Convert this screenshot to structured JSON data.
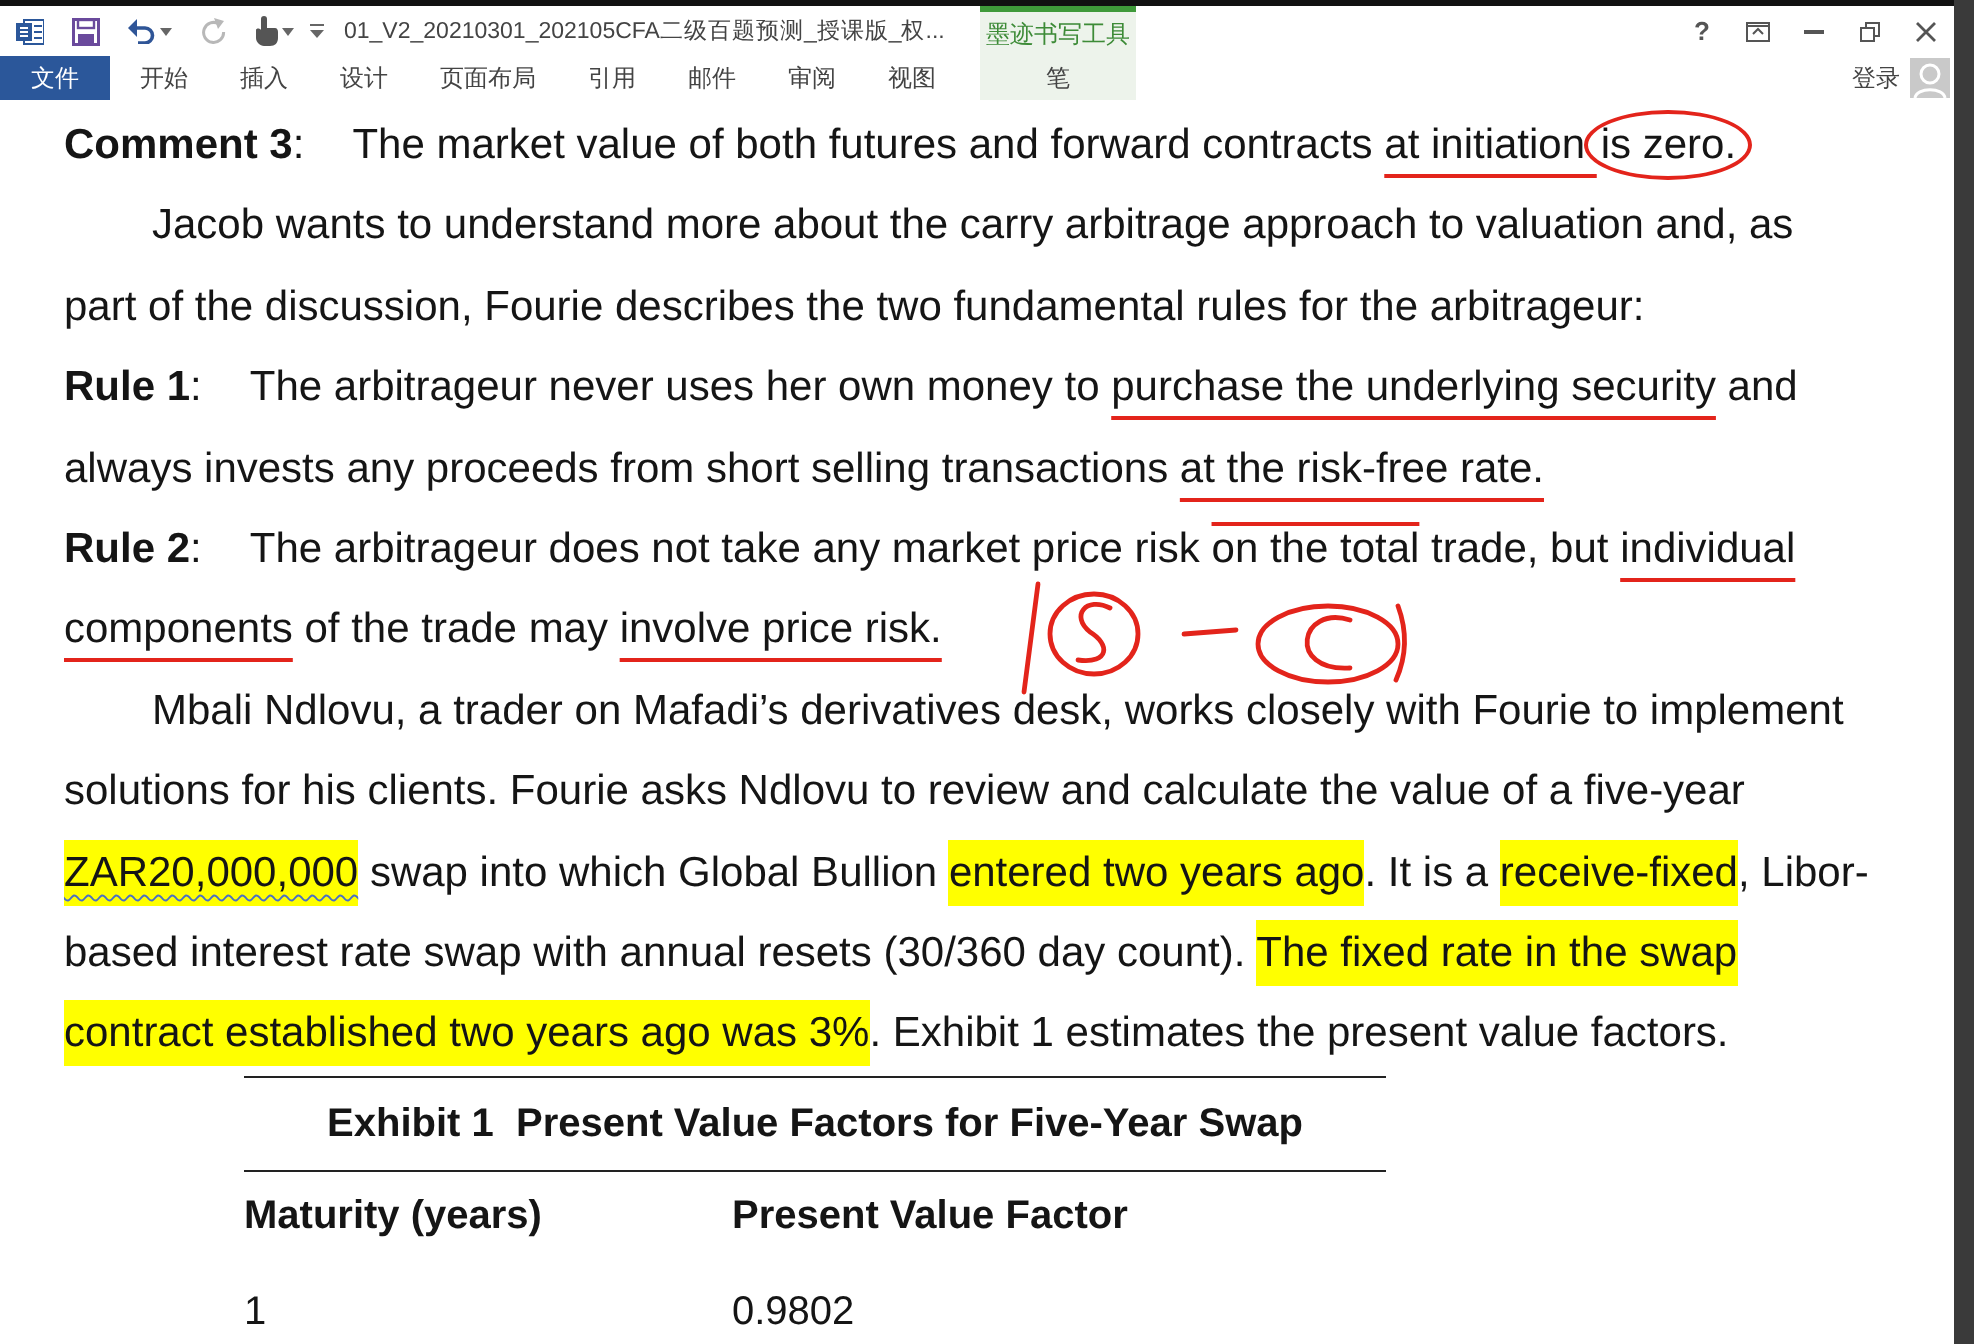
{
  "title_bar": {
    "quick_access": [
      {
        "kind": "save",
        "disabled": false,
        "dropdown": false
      },
      {
        "kind": "undo",
        "disabled": false,
        "dropdown": true
      },
      {
        "kind": "redo",
        "disabled": true,
        "dropdown": false
      },
      {
        "kind": "touch",
        "disabled": false,
        "dropdown": true
      }
    ],
    "title": "01_V2_20210301_202105CFA二级百题预测_授课版_权...",
    "contextual_group": "墨迹书写工具",
    "help": "?"
  },
  "ribbon": {
    "tabs": [
      {
        "label": "文件",
        "kind": "file",
        "selected": false
      },
      {
        "label": "开始",
        "kind": "normal",
        "selected": false
      },
      {
        "label": "插入",
        "kind": "normal",
        "selected": false
      },
      {
        "label": "设计",
        "kind": "normal",
        "selected": false
      },
      {
        "label": "页面布局",
        "kind": "normal",
        "selected": false
      },
      {
        "label": "引用",
        "kind": "normal",
        "selected": false
      },
      {
        "label": "邮件",
        "kind": "normal",
        "selected": false
      },
      {
        "label": "审阅",
        "kind": "normal",
        "selected": false
      },
      {
        "label": "视图",
        "kind": "normal",
        "selected": false
      },
      {
        "label": "笔",
        "kind": "contextual",
        "selected": false
      }
    ],
    "sign_in": "登录"
  },
  "document": {
    "paragraphs": [
      {
        "label": "**Comment 3**:",
        "indent": false,
        "ink_sketch": false,
        "lines": [
          [
            {
              "text": "The market value of both futures and forward contracts ",
              "kind": "plain"
            },
            {
              "text": "at initiation ",
              "kind": "underline"
            },
            {
              "text": "is zero.",
              "kind": "circle"
            }
          ]
        ]
      },
      {
        "indent": true,
        "ink_sketch": false,
        "lines": [
          [
            {
              "text": "Jacob wants to understand more about the carry arbitrage approach to valuation and, as",
              "kind": "plain"
            }
          ],
          [
            {
              "text": "part of the discussion, Fourie describes the two fundamental rules for the arbitrageur:",
              "kind": "plain"
            }
          ]
        ]
      },
      {
        "label": "**Rule 1**:",
        "indent": false,
        "ink_sketch": false,
        "lines": [
          [
            {
              "text": "The arbitrageur never uses her own money to ",
              "kind": "plain"
            },
            {
              "text": "purchase the underlying security",
              "kind": "underline"
            },
            {
              "text": " and",
              "kind": "plain"
            }
          ],
          [
            {
              "text": "always invests any proceeds from short selling transactions ",
              "kind": "plain"
            },
            {
              "text": "at the risk-free rate.",
              "kind": "underline"
            }
          ]
        ]
      },
      {
        "label": "**Rule 2**:",
        "indent": false,
        "ink_sketch": true,
        "lines": [
          [
            {
              "text": "The arbitrageur does not take any market price risk ",
              "kind": "plain"
            },
            {
              "text": "on the total",
              "kind": "overline"
            },
            {
              "text": " trade, but ",
              "kind": "plain"
            },
            {
              "text": "individual",
              "kind": "underline"
            }
          ],
          [
            {
              "text": "components",
              "kind": "underline"
            },
            {
              "text": " of the trade may ",
              "kind": "plain"
            },
            {
              "text": "involve price risk.",
              "kind": "underline"
            }
          ]
        ]
      },
      {
        "indent": true,
        "ink_sketch": false,
        "lines": [
          [
            {
              "text": "Mbali Ndlovu, a trader on Mafadi’s derivatives desk, works closely with Fourie to implement",
              "kind": "plain"
            }
          ],
          [
            {
              "text": "solutions for his clients. Fourie asks Ndlovu to review and calculate the value of a five-year",
              "kind": "plain"
            }
          ],
          [
            {
              "text": "ZAR20,000,000",
              "kind": "flagged"
            },
            {
              "text": " swap into which Global Bullion ",
              "kind": "plain"
            },
            {
              "text": "entered two years ago",
              "kind": "highlight"
            },
            {
              "text": ". It is a ",
              "kind": "plain"
            },
            {
              "text": "receive-fixed",
              "kind": "highlight"
            },
            {
              "text": ", Libor-",
              "kind": "plain"
            }
          ],
          [
            {
              "text": "based interest rate swap with annual resets (30/360 day count). ",
              "kind": "plain"
            },
            {
              "text": "The fixed rate in the swap",
              "kind": "highlight"
            }
          ],
          [
            {
              "text": "contract established two years ago was 3%",
              "kind": "highlight"
            },
            {
              "text": ". Exhibit 1 estimates the present value factors.",
              "kind": "plain"
            }
          ]
        ]
      }
    ],
    "exhibit": {
      "title": "Exhibit 1  Present Value Factors for Five-Year Swap",
      "columns": [
        "Maturity (years)",
        "Present Value Factor"
      ],
      "rows": [
        [
          "1",
          "0.9802"
        ]
      ]
    }
  }
}
